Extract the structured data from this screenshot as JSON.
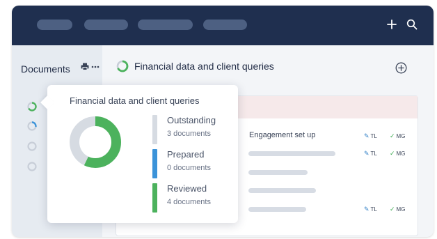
{
  "topbar": {
    "pill_count": 4,
    "add_icon": "plus-icon",
    "search_icon": "search-icon",
    "background": "#1f2f4f",
    "pill_color": "#4d6082"
  },
  "sidebar": {
    "title": "Documents",
    "print_icon": "printer-icon",
    "more_icon": "ellipsis-icon",
    "items": [
      {
        "status": "partial-green"
      },
      {
        "status": "partial-blue"
      },
      {
        "status": "empty"
      },
      {
        "status": "empty"
      }
    ]
  },
  "main": {
    "title": "Financial data and client queries",
    "status_icon": "progress-ring-icon",
    "add_icon": "circle-plus-icon",
    "row": {
      "label": "Engagement set up",
      "tags": [
        {
          "icon": "pencil-icon",
          "text": "TL"
        },
        {
          "icon": "check-icon",
          "text": "MG"
        }
      ]
    }
  },
  "popup": {
    "title": "Financial data and client queries",
    "legend": [
      {
        "label": "Outstanding",
        "sub": "3 documents",
        "color": "#d6dbe2"
      },
      {
        "label": "Prepared",
        "sub": "0 documents",
        "color": "#3b93d9"
      },
      {
        "label": "Reviewed",
        "sub": "4 documents",
        "color": "#4cb25d"
      }
    ]
  },
  "chart_data": {
    "type": "pie",
    "categories": [
      "Outstanding",
      "Prepared",
      "Reviewed"
    ],
    "values": [
      3,
      0,
      4
    ],
    "colors": [
      "#d6dbe2",
      "#3b93d9",
      "#4cb25d"
    ],
    "title": "Financial data and client queries"
  }
}
